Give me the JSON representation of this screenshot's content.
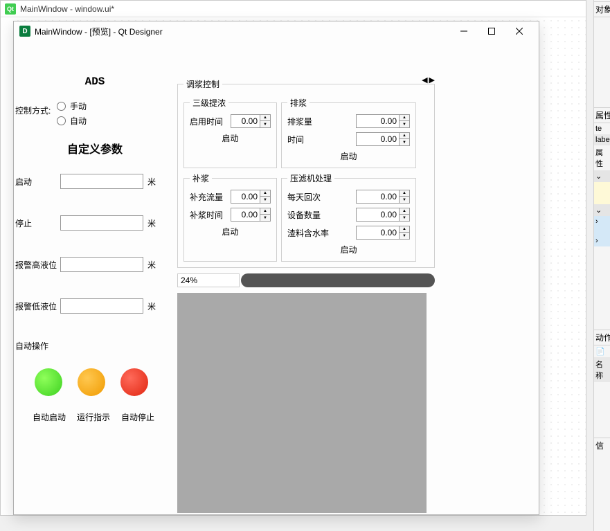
{
  "outer": {
    "title": "MainWindow - window.ui*",
    "qt": "Qt"
  },
  "preview": {
    "title": "MainWindow - [预览] - Qt Designer",
    "icon": "D"
  },
  "ads": "ADS",
  "ctrl": {
    "label": "控制方式:",
    "manual": "手动",
    "auto": "自动"
  },
  "custom_title": "自定义参数",
  "fields": {
    "start": "启动",
    "stop": "停止",
    "alarm_hi": "报警高液位",
    "alarm_lo": "报警低液位",
    "unit": "米"
  },
  "auto_ops": {
    "title": "自动操作",
    "start": "自动启动",
    "run": "运行指示",
    "stop": "自动停止"
  },
  "mix": {
    "title": "调浆控制",
    "g1": {
      "title": "三级提浓",
      "enable_time": "启用时间",
      "val": "0.00",
      "start": "启动"
    },
    "g2": {
      "title": "排浆",
      "amount": "排浆量",
      "time": "时间",
      "v1": "0.00",
      "v2": "0.00",
      "start": "启动"
    },
    "g3": {
      "title": "补浆",
      "flow": "补充流量",
      "time": "补浆时间",
      "v1": "0.00",
      "v2": "0.00",
      "start": "启动"
    },
    "g4": {
      "title": "压滤机处理",
      "times": "每天回次",
      "count": "设备数量",
      "water": "渣料含水率",
      "v1": "0.00",
      "v2": "0.00",
      "v3": "0.00",
      "start": "启动"
    }
  },
  "progress": "24%",
  "rfrag": {
    "s1": "对象",
    "s2": "属性",
    "s3": "te",
    "s4": "labe",
    "s5": "属性",
    "s6": "动作",
    "s7": "名称",
    "s8": "信"
  }
}
